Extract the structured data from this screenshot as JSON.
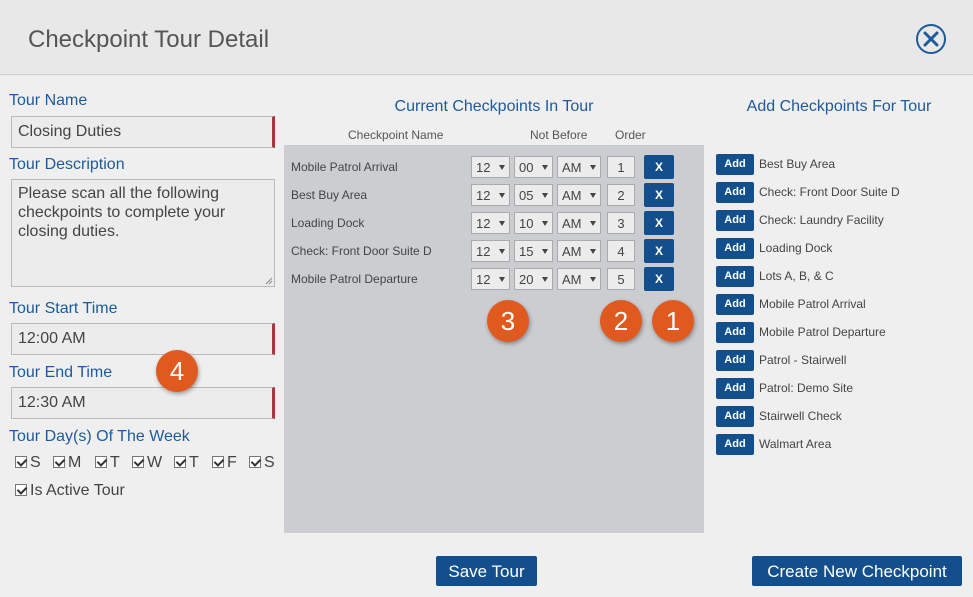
{
  "header": {
    "title": "Checkpoint Tour Detail"
  },
  "left": {
    "tour_name_label": "Tour Name",
    "tour_name_value": "Closing Duties",
    "description_label": "Tour Description",
    "description_value": "Please scan all the following checkpoints to complete your closing duties.",
    "start_label": "Tour Start Time",
    "start_value": "12:00 AM",
    "end_label": "Tour End Time",
    "end_value": "12:30 AM",
    "days_label": "Tour Day(s) Of The Week",
    "days": [
      "S",
      "M",
      "T",
      "W",
      "T",
      "F",
      "S"
    ],
    "active_label": "Is Active Tour"
  },
  "center": {
    "title": "Current Checkpoints In Tour",
    "col_name": "Checkpoint Name",
    "col_not_before": "Not Before",
    "col_order": "Order",
    "x_label": "X",
    "rows": [
      {
        "name": "Mobile Patrol Arrival",
        "hour": "12",
        "minute": "00",
        "ampm": "AM",
        "order": "1"
      },
      {
        "name": "Best Buy Area",
        "hour": "12",
        "minute": "05",
        "ampm": "AM",
        "order": "2"
      },
      {
        "name": "Loading Dock",
        "hour": "12",
        "minute": "10",
        "ampm": "AM",
        "order": "3"
      },
      {
        "name": "Check: Front Door Suite D",
        "hour": "12",
        "minute": "15",
        "ampm": "AM",
        "order": "4"
      },
      {
        "name": "Mobile Patrol Departure",
        "hour": "12",
        "minute": "20",
        "ampm": "AM",
        "order": "5"
      }
    ]
  },
  "right": {
    "title": "Add Checkpoints For Tour",
    "add_label": "Add",
    "items": [
      "Best Buy Area",
      "Check: Front Door Suite D",
      "Check: Laundry Facility",
      "Loading Dock",
      "Lots A, B, & C",
      "Mobile Patrol Arrival",
      "Mobile Patrol Departure",
      "Patrol - Stairwell",
      "Patrol: Demo Site",
      "Stairwell Check",
      "Walmart Area"
    ]
  },
  "footer": {
    "save_label": "Save Tour",
    "create_label": "Create New Checkpoint"
  },
  "badges": [
    "1",
    "2",
    "3",
    "4"
  ],
  "colors": {
    "accent": "#134f8d",
    "badge": "#e05a1f",
    "label": "#1e5a9a"
  }
}
